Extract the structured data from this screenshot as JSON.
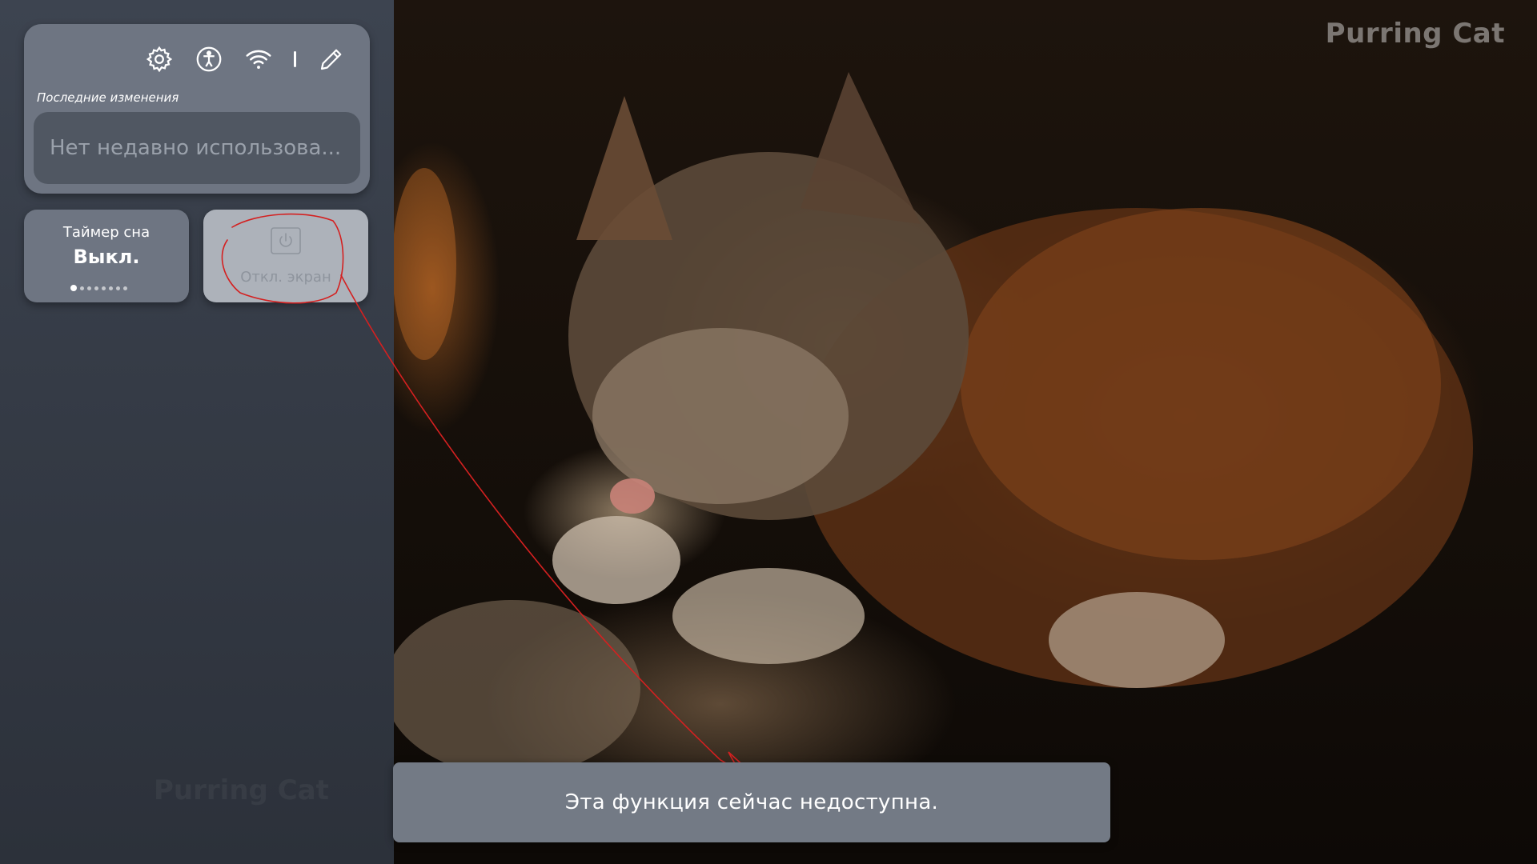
{
  "brand": {
    "watermark": "Purring Cat",
    "panel_watermark": "Purring Cat"
  },
  "quick_panel": {
    "toolbar": {
      "icons": [
        "gear-icon",
        "accessibility-icon",
        "wifi-icon",
        "pencil-icon"
      ]
    },
    "recent": {
      "label": "Последние изменения",
      "empty_text": "Нет недавно использова..."
    },
    "sleep_timer": {
      "title": "Таймер сна",
      "value": "Выкл.",
      "page_count": 8,
      "active_page": 1
    },
    "screen_off": {
      "label": "Откл. экран",
      "icon": "power-icon",
      "disabled": true
    }
  },
  "toast": {
    "message": "Эта функция сейчас недоступна."
  },
  "colors": {
    "panel_bg": "#353b46",
    "card_bg": "#6e7582",
    "disabled_tile_bg": "#adb2ba",
    "toast_bg": "#737a85",
    "annotation": "#d42020"
  }
}
